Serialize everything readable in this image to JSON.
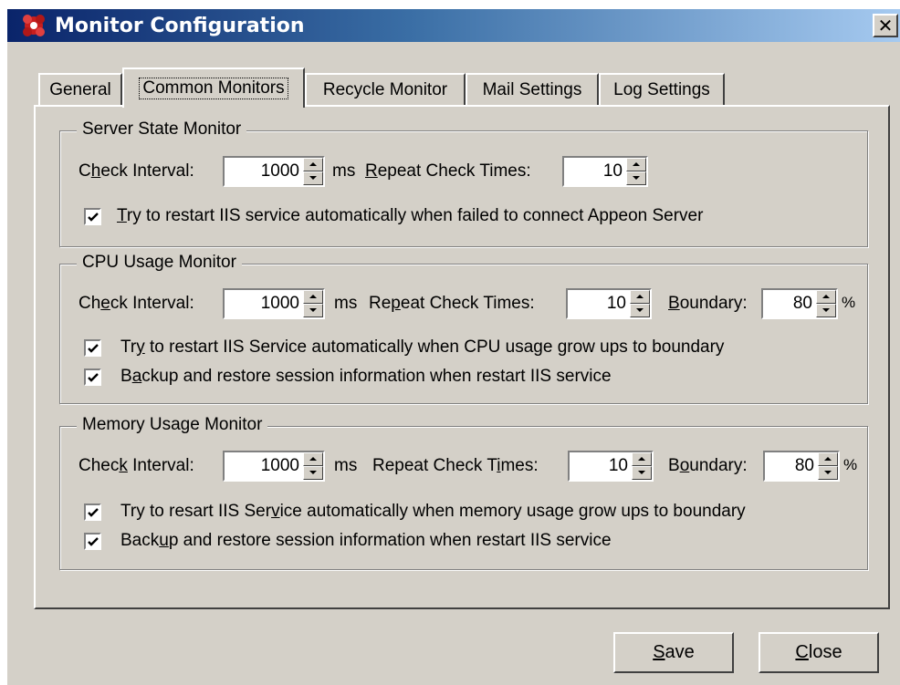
{
  "window": {
    "title": "Monitor Configuration",
    "close_glyph": "✕"
  },
  "tabs": [
    {
      "label": "General",
      "active": false
    },
    {
      "label": "Common Monitors",
      "active": true
    },
    {
      "label": "Recycle Monitor",
      "active": false
    },
    {
      "label": "Mail Settings",
      "active": false
    },
    {
      "label": "Log Settings",
      "active": false
    }
  ],
  "server_state": {
    "title": "Server State Monitor",
    "check_interval_pre": "C",
    "check_interval_acc": "h",
    "check_interval_post": "eck Interval:",
    "interval_value": "1000",
    "ms": "ms",
    "repeat_pre": "",
    "repeat_acc": "R",
    "repeat_post": "epeat Check Times:",
    "repeat_value": "10",
    "restart_pre": "",
    "restart_acc": "T",
    "restart_post": "ry to restart IIS service automatically when failed to connect Appeon Server",
    "restart_checked": true
  },
  "cpu": {
    "title": "CPU Usage Monitor",
    "check_interval_pre": "Ch",
    "check_interval_acc": "e",
    "check_interval_post": "ck Interval:",
    "interval_value": "1000",
    "ms": "ms",
    "repeat_pre": "Re",
    "repeat_acc": "p",
    "repeat_post": "eat Check Times:",
    "repeat_value": "10",
    "boundary_pre": "",
    "boundary_acc": "B",
    "boundary_post": "oundary:",
    "boundary_value": "80",
    "percent": "%",
    "restart_pre": "Tr",
    "restart_acc": "y",
    "restart_post": " to restart IIS Service automatically when  CPU usage grow ups to boundary",
    "restart_checked": true,
    "backup_pre": "B",
    "backup_acc": "a",
    "backup_post": "ckup and restore session information when restart IIS service",
    "backup_checked": true
  },
  "memory": {
    "title": "Memory Usage Monitor",
    "check_interval_pre": "Chec",
    "check_interval_acc": "k",
    "check_interval_post": " Interval:",
    "interval_value": "1000",
    "ms": "ms",
    "repeat_pre": "Repeat Check T",
    "repeat_acc": "i",
    "repeat_post": "mes:",
    "repeat_value": "10",
    "boundary_pre": "B",
    "boundary_acc": "o",
    "boundary_post": "undary:",
    "boundary_value": "80",
    "percent": "%",
    "restart_pre": "Try to resart IIS Ser",
    "restart_acc": "v",
    "restart_post": "ice automatically when memory usage grow ups to boundary",
    "restart_checked": true,
    "backup_pre": "Back",
    "backup_acc": "u",
    "backup_post": "p and restore session information when restart IIS service",
    "backup_checked": true
  },
  "buttons": {
    "save_acc": "S",
    "save_post": "ave",
    "close_acc": "C",
    "close_post": "lose"
  }
}
